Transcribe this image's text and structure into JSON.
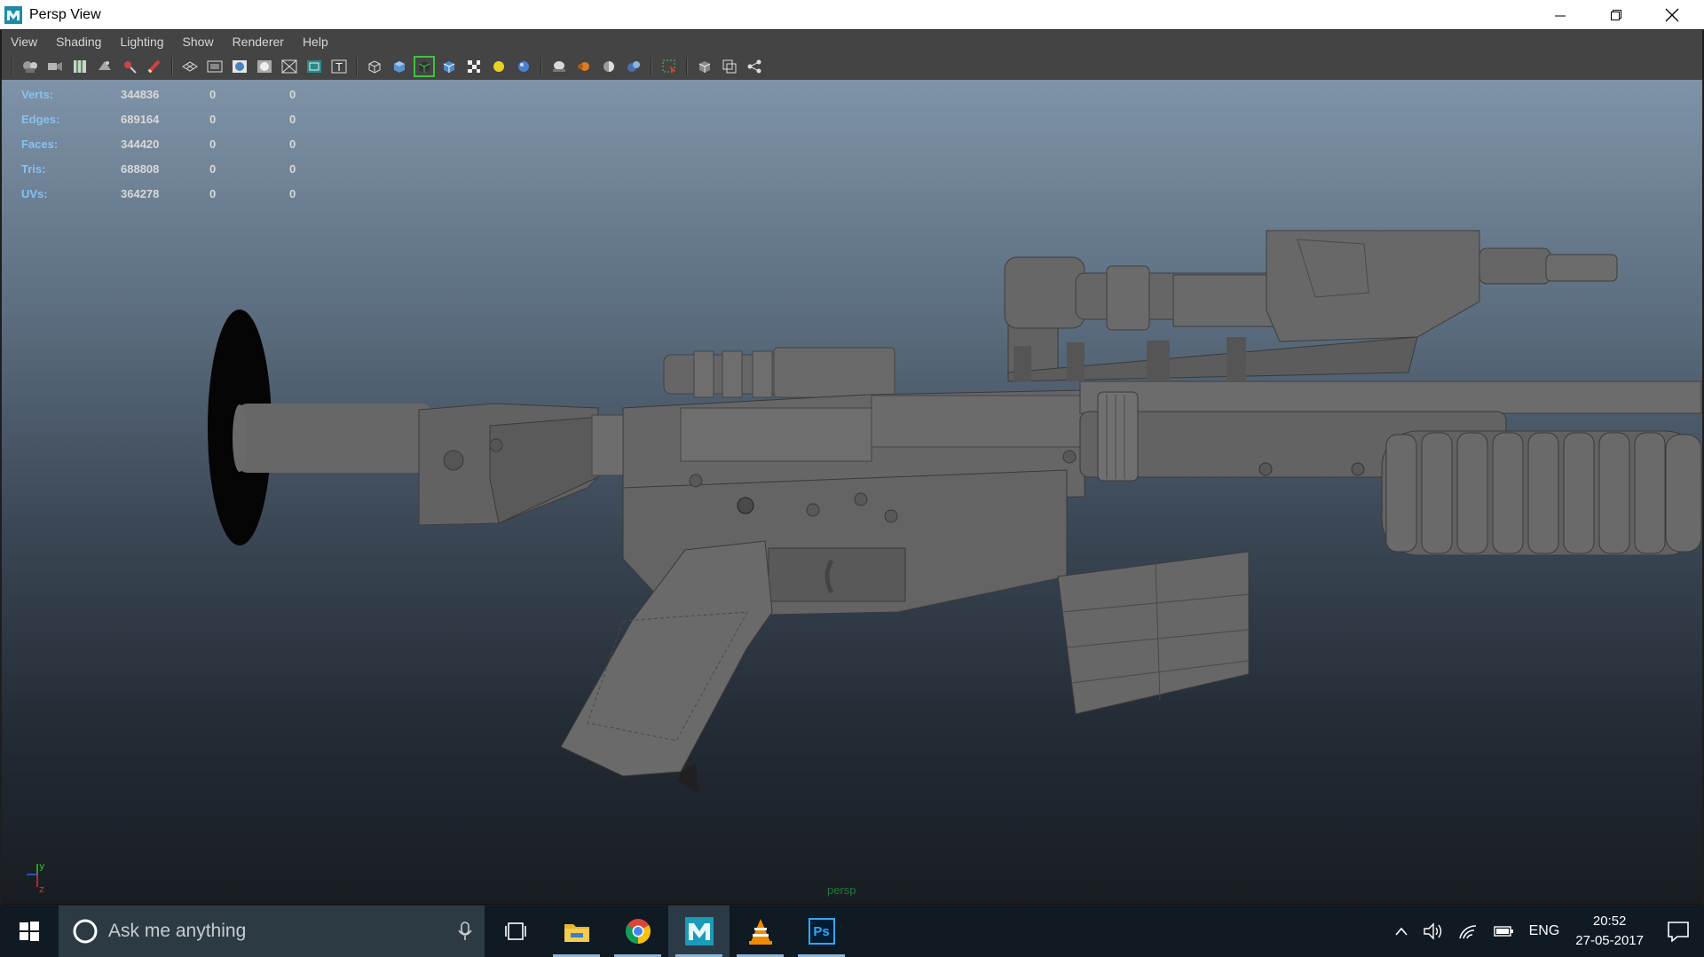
{
  "window": {
    "title": "Persp View"
  },
  "menu": [
    "View",
    "Shading",
    "Lighting",
    "Show",
    "Renderer",
    "Help"
  ],
  "hud": {
    "rows": [
      {
        "label": "Verts:",
        "v1": "344836",
        "v2": "0",
        "v3": "0"
      },
      {
        "label": "Edges:",
        "v1": "689164",
        "v2": "0",
        "v3": "0"
      },
      {
        "label": "Faces:",
        "v1": "344420",
        "v2": "0",
        "v3": "0"
      },
      {
        "label": "Tris:",
        "v1": "688808",
        "v2": "0",
        "v3": "0"
      },
      {
        "label": "UVs:",
        "v1": "364278",
        "v2": "0",
        "v3": "0"
      }
    ]
  },
  "viewport": {
    "camera_name": "persp",
    "axis_labels": {
      "y": "y",
      "z": "z"
    }
  },
  "taskbar": {
    "search_placeholder": "Ask me anything",
    "apps": [
      "task-view",
      "file-explorer",
      "chrome",
      "maya",
      "vlc",
      "photoshop"
    ],
    "photoshop_label": "Ps",
    "language": "ENG",
    "time": "20:52",
    "date": "27-05-2017"
  },
  "colors": {
    "menubar_bg": "#444444",
    "viewport_top": "#7f93a8",
    "viewport_bottom": "#191d22",
    "hud_label": "#86c1f0",
    "model_gray": "#6b6b6b",
    "taskbar_bg": "#0f1a22",
    "active_outline": "#3fc23f"
  }
}
